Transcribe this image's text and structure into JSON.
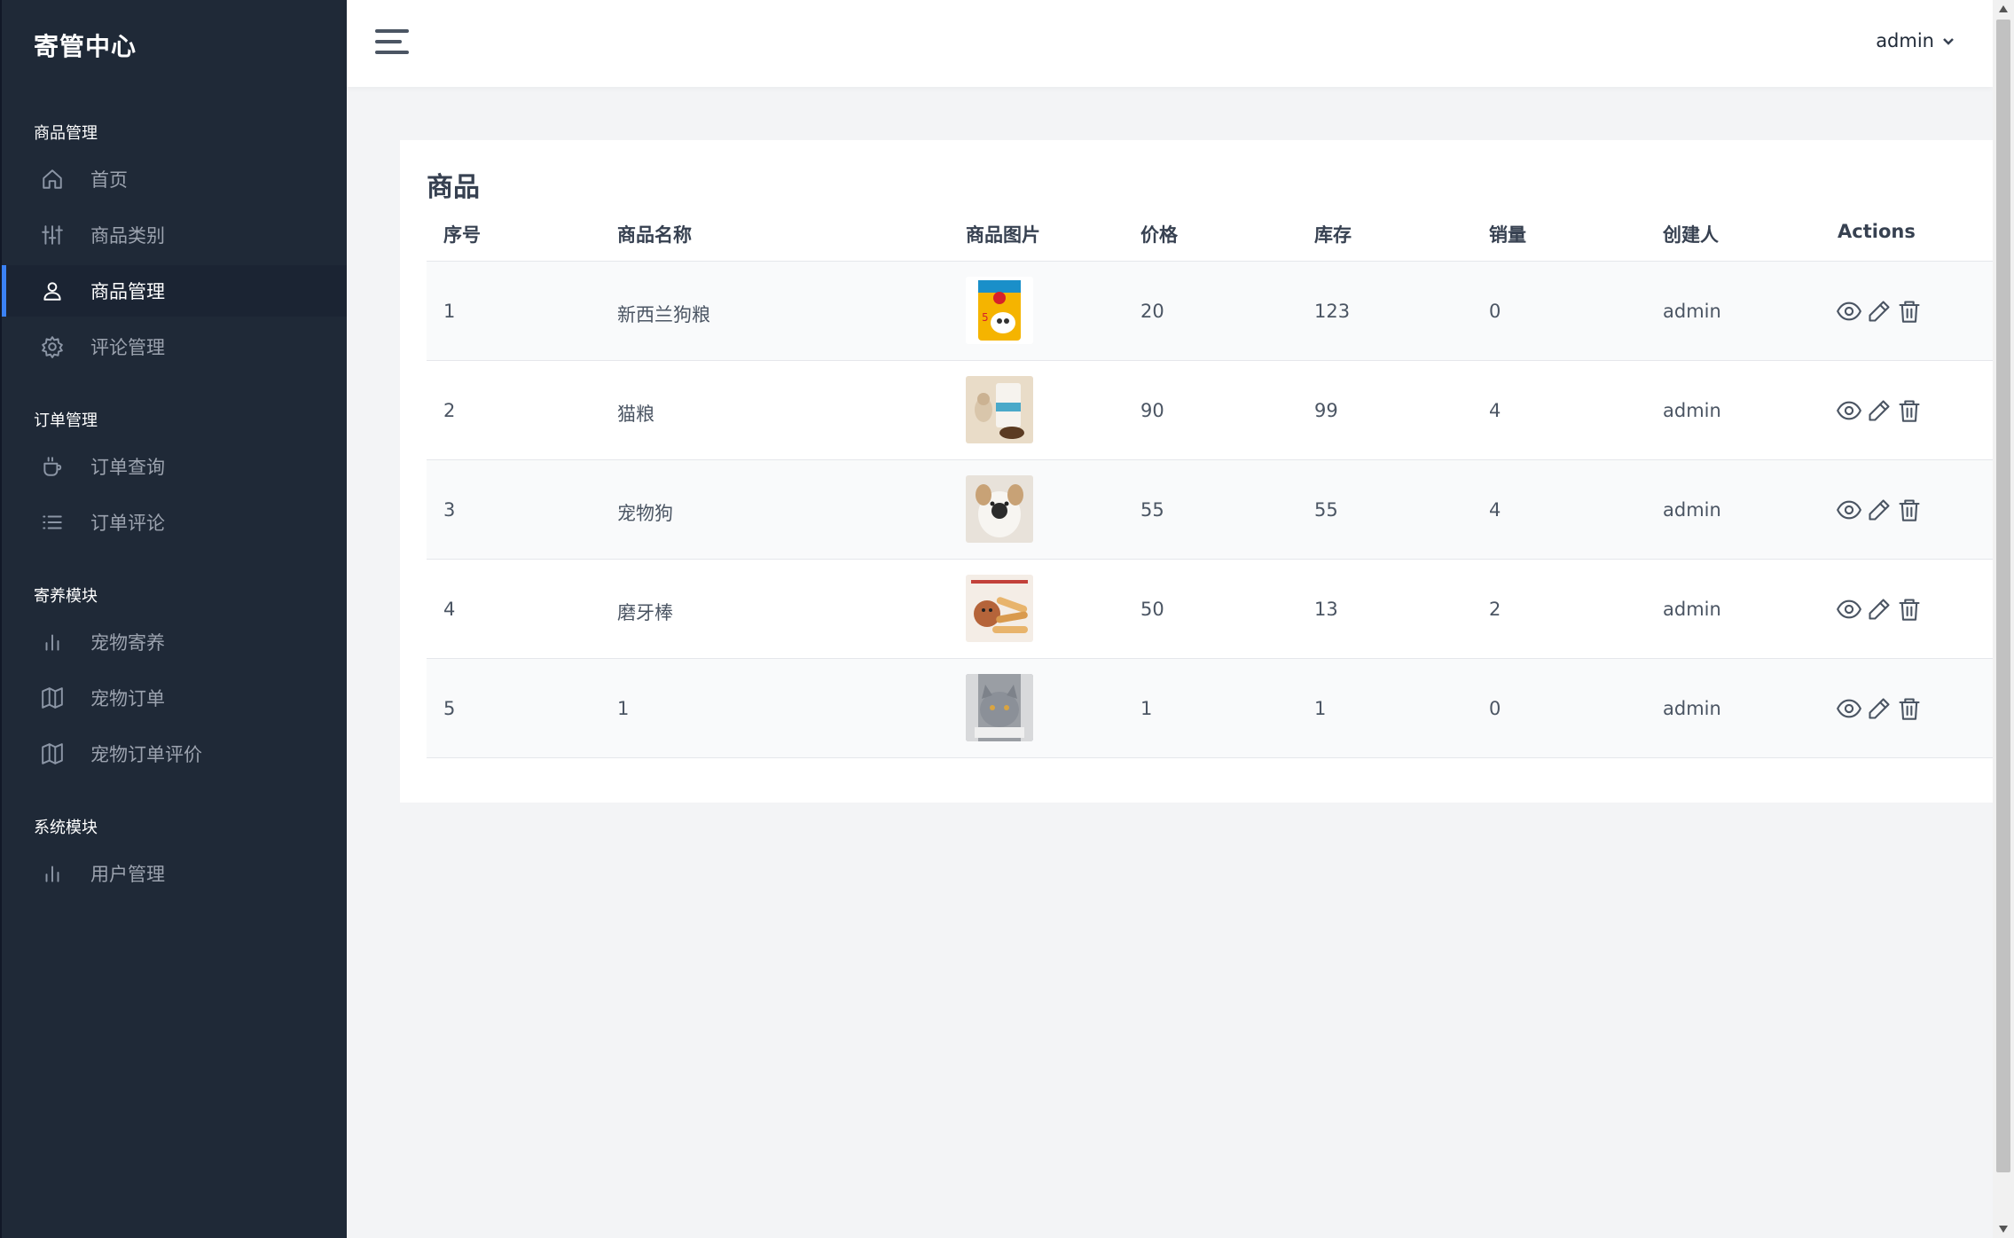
{
  "sidebar": {
    "brand": "寄管中心",
    "sections": [
      {
        "title": "商品管理",
        "items": [
          {
            "label": "首页",
            "icon": "home-icon"
          },
          {
            "label": "商品类别",
            "icon": "sliders-icon"
          },
          {
            "label": "商品管理",
            "icon": "user-icon",
            "active": true
          },
          {
            "label": "评论管理",
            "icon": "gear-icon"
          }
        ]
      },
      {
        "title": "订单管理",
        "items": [
          {
            "label": "订单查询",
            "icon": "cup-icon"
          },
          {
            "label": "订单评论",
            "icon": "list-icon"
          }
        ]
      },
      {
        "title": "寄养模块",
        "items": [
          {
            "label": "宠物寄养",
            "icon": "bar-chart-icon"
          },
          {
            "label": "宠物订单",
            "icon": "map-icon"
          },
          {
            "label": "宠物订单评价",
            "icon": "map-icon"
          }
        ]
      },
      {
        "title": "系统模块",
        "items": [
          {
            "label": "用户管理",
            "icon": "bar-chart-icon"
          }
        ]
      }
    ]
  },
  "header": {
    "user": "admin"
  },
  "main": {
    "title": "商品",
    "columns": [
      "序号",
      "商品名称",
      "商品图片",
      "价格",
      "库存",
      "销量",
      "创建人",
      "Actions"
    ],
    "rows": [
      {
        "id": "1",
        "name": "新西兰狗粮",
        "image": "dog-food-pouch",
        "price": "20",
        "stock": "123",
        "sales": "0",
        "creator": "admin"
      },
      {
        "id": "2",
        "name": "猫粮",
        "image": "cat-food-bag",
        "price": "90",
        "stock": "99",
        "sales": "4",
        "creator": "admin"
      },
      {
        "id": "3",
        "name": "宠物狗",
        "image": "puppy-photo",
        "price": "55",
        "stock": "55",
        "sales": "4",
        "creator": "admin"
      },
      {
        "id": "4",
        "name": "磨牙棒",
        "image": "chew-stick-photo",
        "price": "50",
        "stock": "13",
        "sales": "2",
        "creator": "admin"
      },
      {
        "id": "5",
        "name": "1",
        "image": "cat-photo",
        "price": "1",
        "stock": "1",
        "sales": "0",
        "creator": "admin"
      }
    ]
  },
  "colors": {
    "sidebar_bg": "#1f2937",
    "accent": "#3b82f6",
    "page_bg": "#f3f4f6"
  }
}
